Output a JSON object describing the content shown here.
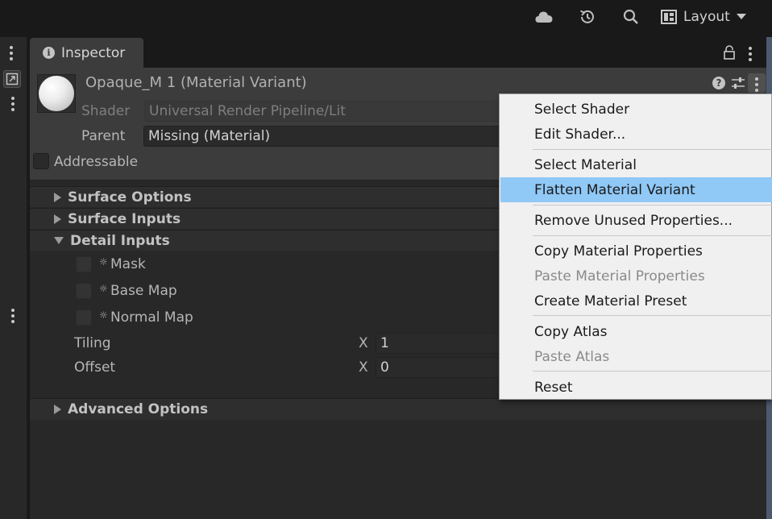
{
  "toolbar": {
    "icons": [
      "cloud-icon",
      "history-icon",
      "search-icon"
    ],
    "layout_label": "Layout"
  },
  "tab": {
    "label": "Inspector"
  },
  "material": {
    "title": "Opaque_M 1 (Material Variant)",
    "shader_label": "Shader",
    "shader_value": "Universal Render Pipeline/Lit",
    "parent_label": "Parent",
    "parent_value": "Missing (Material)",
    "addressable_label": "Addressable"
  },
  "sections": {
    "surface_options": "Surface Options",
    "surface_inputs": "Surface Inputs",
    "detail_inputs": "Detail Inputs",
    "advanced_options": "Advanced Options"
  },
  "detail": {
    "mask": "Mask",
    "base_map": "Base Map",
    "normal_map": "Normal Map",
    "tiling_label": "Tiling",
    "tiling_axis": "X",
    "tiling_x": "1",
    "offset_label": "Offset",
    "offset_axis": "X",
    "offset_x": "0"
  },
  "context_menu": {
    "items": [
      {
        "label": "Select Shader",
        "enabled": true
      },
      {
        "label": "Edit Shader...",
        "enabled": true
      },
      {
        "label": "Select Material",
        "enabled": true
      },
      {
        "label": "Flatten Material Variant",
        "enabled": true,
        "highlighted": true
      },
      {
        "label": "Remove Unused Properties...",
        "enabled": true
      },
      {
        "label": "Copy Material Properties",
        "enabled": true
      },
      {
        "label": "Paste Material Properties",
        "enabled": false
      },
      {
        "label": "Create Material Preset",
        "enabled": true
      },
      {
        "label": "Copy Atlas",
        "enabled": true
      },
      {
        "label": "Paste Atlas",
        "enabled": false
      },
      {
        "label": "Reset",
        "enabled": true
      }
    ]
  },
  "colors": {
    "menu_highlight": "#90c8f6",
    "panel_bg": "#282828",
    "header_bg": "#3c3c3c"
  }
}
